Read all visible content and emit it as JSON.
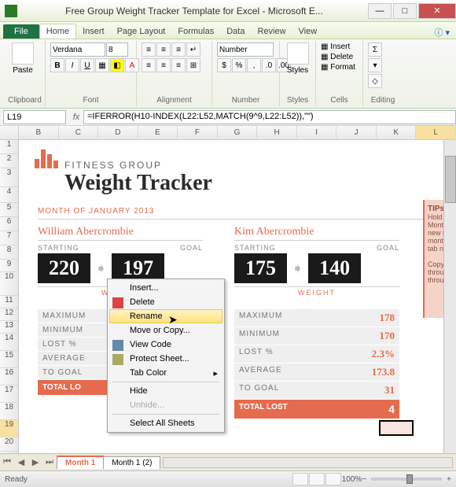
{
  "window": {
    "title": "Free Group Weight Tracker Template for Excel - Microsoft E..."
  },
  "menu": {
    "file": "File",
    "tabs": [
      "Home",
      "Insert",
      "Page Layout",
      "Formulas",
      "Data",
      "Review",
      "View"
    ],
    "active": "Home"
  },
  "ribbon": {
    "paste": "Paste",
    "clipboard": "Clipboard",
    "font_name": "Verdana",
    "font_size": "8",
    "font": "Font",
    "alignment": "Alignment",
    "num_format": "Number",
    "number": "Number",
    "styles": "Styles",
    "styles_btn": "Styles",
    "insert": "Insert",
    "delete": "Delete",
    "format": "Format",
    "cells": "Cells",
    "editing": "Editing"
  },
  "namebox": "L19",
  "formula": "=IFERROR(H10-INDEX(L22:L52,MATCH(9^9,L22:L52)),\"\")",
  "columns": [
    "B",
    "C",
    "D",
    "E",
    "F",
    "G",
    "H",
    "I",
    "J",
    "K",
    "L"
  ],
  "rows": [
    "1",
    "2",
    "3",
    "4",
    "5",
    "6",
    "7",
    "8",
    "9",
    "10",
    "11",
    "12",
    "13",
    "14",
    "15",
    "16",
    "17",
    "18",
    "19",
    "20"
  ],
  "doc": {
    "group_upper": "FITNESS GROUP",
    "title": "Weight Tracker",
    "month": "MONTH OF JANUARY 2013",
    "starting": "STARTING",
    "goal": "GOAL",
    "weight": "WEIGHT",
    "people": [
      {
        "name": "William Abercrombie",
        "start": "220",
        "goal": "197"
      },
      {
        "name": "Kim Abercrombie",
        "start": "175",
        "goal": "140"
      }
    ],
    "labels": {
      "max": "MAXIMUM",
      "min": "MINIMUM",
      "lost": "LOST %",
      "avg": "AVERAGE",
      "togoal": "TO GOAL",
      "total": "TOTAL LOST"
    },
    "total_lost_left": "TOTAL LO",
    "stats2": {
      "max": "178",
      "min": "170",
      "lost": "2.3%",
      "avg": "173.8",
      "togoal": "31",
      "total": "4"
    }
  },
  "tips": {
    "head": "TIPs:",
    "l1": "Hold t",
    "l2": "Month",
    "l3": "new r",
    "l4": "month",
    "l5": "tab n",
    "l6": "Copy",
    "l7": "throu",
    "l8": "throu"
  },
  "context": {
    "insert": "Insert...",
    "delete": "Delete",
    "rename": "Rename",
    "move": "Move or Copy...",
    "viewcode": "View Code",
    "protect": "Protect Sheet...",
    "tabcolor": "Tab Color",
    "hide": "Hide",
    "unhide": "Unhide...",
    "selectall": "Select All Sheets"
  },
  "sheets": {
    "t1": "Month 1",
    "t2": "Month 1 (2)"
  },
  "status": {
    "ready": "Ready",
    "zoom": "100%"
  }
}
